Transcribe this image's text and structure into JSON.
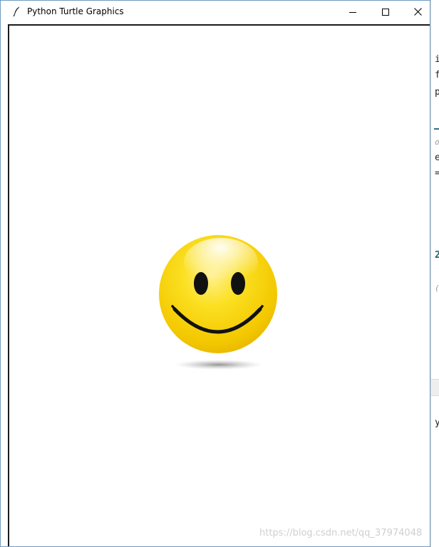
{
  "window": {
    "title": "Python Turtle Graphics"
  },
  "icons": {
    "app": "feather-icon",
    "minimize": "minimize-icon",
    "maximize": "maximize-icon",
    "close": "close-icon"
  },
  "canvas": {
    "drawing": "smiley-face",
    "face_color": "#F9D30A",
    "feature_color": "#111111"
  },
  "background_editor": {
    "fragments": [
      "i",
      "f",
      "p",
      "o",
      "e",
      "=",
      "2",
      "(",
      "y"
    ]
  },
  "watermark": "https://blog.csdn.net/qq_37974048"
}
